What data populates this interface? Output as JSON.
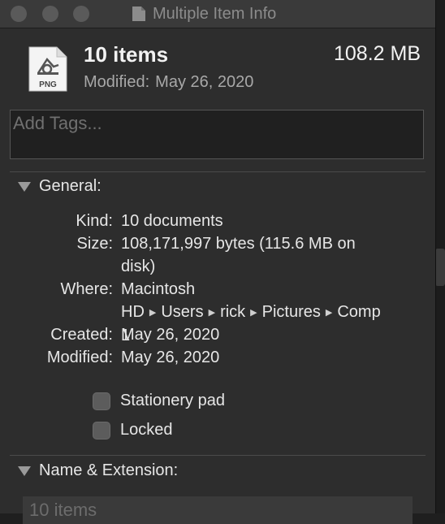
{
  "window": {
    "title": "Multiple Item Info"
  },
  "header": {
    "icon_label": "PNG",
    "item_count": "10 items",
    "total_size": "108.2 MB",
    "modified_label": "Modified:",
    "modified_value": "May 26, 2020"
  },
  "tags": {
    "placeholder": "Add Tags..."
  },
  "general": {
    "title": "General:",
    "kind_label": "Kind:",
    "kind_value": "10 documents",
    "size_label": "Size:",
    "size_value": "108,171,997 bytes (115.6 MB on disk)",
    "where_label": "Where:",
    "where_path": [
      "Macintosh HD",
      "Users",
      "rick",
      "Pictures",
      "Comp 1"
    ],
    "created_label": "Created:",
    "created_value": "May 26, 2020",
    "modified_label": "Modified:",
    "modified_value": "May 26, 2020",
    "stationery_label": "Stationery pad",
    "stationery_checked": false,
    "locked_label": "Locked",
    "locked_checked": false
  },
  "name_extension": {
    "title": "Name & Extension:",
    "name_value": "10 items"
  }
}
